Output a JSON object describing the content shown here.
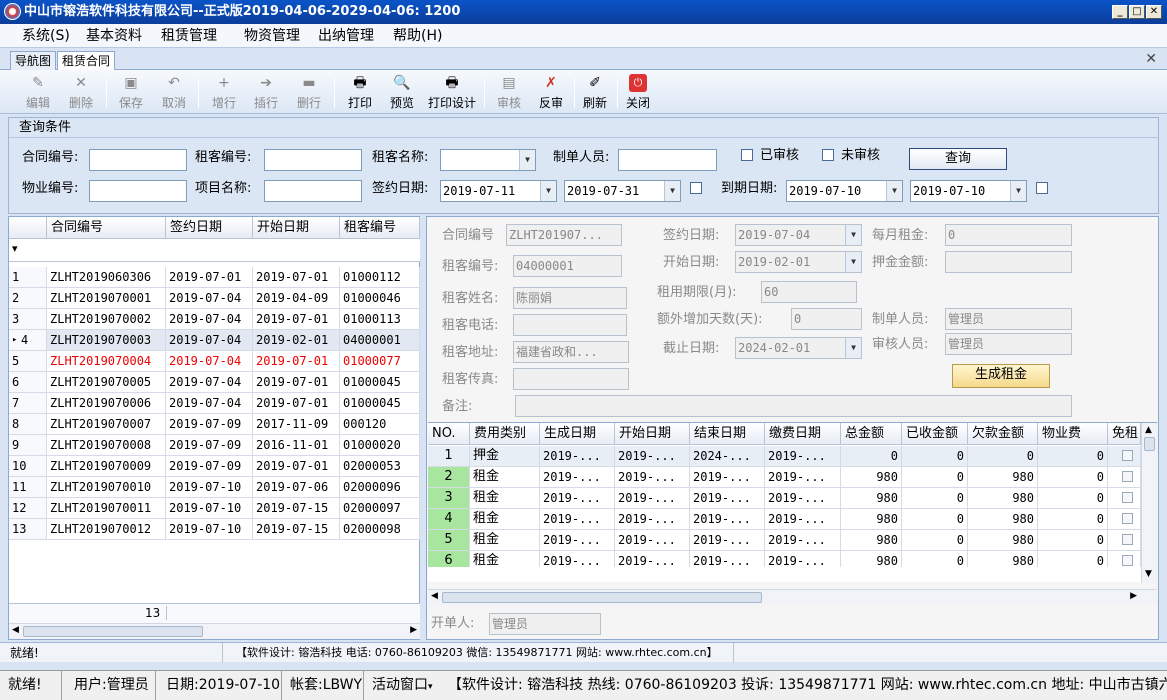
{
  "window": {
    "title": "中山市镕浩软件科技有限公司--正式版2019-04-06-2029-04-06: 1200"
  },
  "menu": [
    "系统(S)",
    "基本资料",
    "租赁管理",
    "物资管理",
    "出纳管理",
    "帮助(H)"
  ],
  "tabs": [
    "导航图",
    "租赁合同"
  ],
  "toolbar": [
    {
      "label": "编辑",
      "icon": "pencil-icon",
      "enabled": false
    },
    {
      "label": "删除",
      "icon": "delete-x-icon",
      "enabled": false
    },
    {
      "label": "保存",
      "icon": "save-icon",
      "enabled": false
    },
    {
      "label": "取消",
      "icon": "undo-icon",
      "enabled": false
    },
    {
      "label": "增行",
      "icon": "plus-icon",
      "enabled": false
    },
    {
      "label": "插行",
      "icon": "insert-arrow-icon",
      "enabled": false
    },
    {
      "label": "删行",
      "icon": "minus-icon",
      "enabled": false
    },
    {
      "label": "打印",
      "icon": "printer-icon",
      "enabled": true
    },
    {
      "label": "预览",
      "icon": "preview-icon",
      "enabled": true
    },
    {
      "label": "打印设计",
      "icon": "print-design-icon",
      "enabled": true
    },
    {
      "label": "审核",
      "icon": "approve-icon",
      "enabled": false
    },
    {
      "label": "反审",
      "icon": "unapprove-icon",
      "enabled": true
    },
    {
      "label": "刷新",
      "icon": "refresh-icon",
      "enabled": true
    },
    {
      "label": "关闭",
      "icon": "power-icon",
      "enabled": true
    }
  ],
  "query": {
    "title": "查询条件",
    "contract_no_label": "合同编号:",
    "tenant_no_label": "租客编号:",
    "tenant_name_label": "租客名称:",
    "creator_label": "制单人员:",
    "approved_label": "已审核",
    "unapproved_label": "未审核",
    "search_button": "查询",
    "property_no_label": "物业编号:",
    "project_name_label": "项目名称:",
    "sign_date_label": "签约日期:",
    "sign_date_from": "2019-07-11",
    "sign_date_to": "2019-07-31",
    "expire_date_label": "到期日期:",
    "expire_date_from": "2019-07-10",
    "expire_date_to": "2019-07-10"
  },
  "contract_grid": {
    "headers": [
      "合同编号",
      "签约日期",
      "开始日期",
      "租客编号"
    ],
    "filter_icon": "▾",
    "rows": [
      {
        "no": "1",
        "c": [
          "ZLHT2019060306",
          "2019-07-01",
          "2019-07-01",
          "01000112"
        ]
      },
      {
        "no": "2",
        "c": [
          "ZLHT2019070001",
          "2019-07-04",
          "2019-04-09",
          "01000046"
        ]
      },
      {
        "no": "3",
        "c": [
          "ZLHT2019070002",
          "2019-07-04",
          "2019-07-01",
          "01000113"
        ]
      },
      {
        "no": "4",
        "c": [
          "ZLHT2019070003",
          "2019-07-04",
          "2019-02-01",
          "04000001"
        ]
      },
      {
        "no": "5",
        "c": [
          "ZLHT2019070004",
          "2019-07-04",
          "2019-07-01",
          "01000077"
        ]
      },
      {
        "no": "6",
        "c": [
          "ZLHT2019070005",
          "2019-07-04",
          "2019-07-01",
          "01000045"
        ]
      },
      {
        "no": "7",
        "c": [
          "ZLHT2019070006",
          "2019-07-04",
          "2019-07-01",
          "01000045"
        ]
      },
      {
        "no": "8",
        "c": [
          "ZLHT2019070007",
          "2019-07-09",
          "2017-11-09",
          "000120"
        ]
      },
      {
        "no": "9",
        "c": [
          "ZLHT2019070008",
          "2019-07-09",
          "2016-11-01",
          "01000020"
        ]
      },
      {
        "no": "10",
        "c": [
          "ZLHT2019070009",
          "2019-07-09",
          "2019-07-01",
          "02000053"
        ]
      },
      {
        "no": "11",
        "c": [
          "ZLHT2019070010",
          "2019-07-10",
          "2019-07-06",
          "02000096"
        ]
      },
      {
        "no": "12",
        "c": [
          "ZLHT2019070011",
          "2019-07-10",
          "2019-07-15",
          "02000097"
        ]
      },
      {
        "no": "13",
        "c": [
          "ZLHT2019070012",
          "2019-07-10",
          "2019-07-15",
          "02000098"
        ]
      }
    ],
    "current_row": 4,
    "red_row": 5,
    "count": "13"
  },
  "detail_form": {
    "contract_no_label": "合同编号",
    "contract_no": "ZLHT201907...",
    "sign_date_label": "签约日期:",
    "sign_date": "2019-07-04",
    "monthly_rent_label": "每月租金:",
    "monthly_rent": "0",
    "tenant_no_label": "租客编号:",
    "tenant_no": "04000001",
    "start_date_label": "开始日期:",
    "start_date": "2019-02-01",
    "deposit_label": "押金金额:",
    "deposit": "",
    "tenant_name_label": "租客姓名:",
    "tenant_name": "陈丽娟",
    "term_label": "租用期限(月):",
    "term": "60",
    "tenant_phone_label": "租客电话:",
    "tenant_phone": "",
    "extra_days_label": "额外增加天数(天):",
    "extra_days": "0",
    "creator_label": "制单人员:",
    "creator": "管理员",
    "tenant_addr_label": "租客地址:",
    "tenant_addr": "福建省政和...",
    "end_date_label": "截止日期:",
    "end_date": "2024-02-01",
    "auditor_label": "审核人员:",
    "auditor": "管理员",
    "tenant_fax_label": "租客传真:",
    "tenant_fax": "",
    "gen_rent_button": "生成租金",
    "remark_label": "备注:",
    "remark": ""
  },
  "fee_grid": {
    "headers": [
      "NO.",
      "费用类别",
      "生成日期",
      "开始日期",
      "结束日期",
      "缴费日期",
      "总金额",
      "已收金额",
      "欠款金额",
      "物业费",
      "免租"
    ],
    "rows": [
      {
        "c": [
          "1",
          "押金",
          "2019-...",
          "2019-...",
          "2024-...",
          "2019-...",
          "0",
          "0",
          "0",
          "0"
        ]
      },
      {
        "c": [
          "2",
          "租金",
          "2019-...",
          "2019-...",
          "2019-...",
          "2019-...",
          "980",
          "0",
          "980",
          "0"
        ]
      },
      {
        "c": [
          "3",
          "租金",
          "2019-...",
          "2019-...",
          "2019-...",
          "2019-...",
          "980",
          "0",
          "980",
          "0"
        ]
      },
      {
        "c": [
          "4",
          "租金",
          "2019-...",
          "2019-...",
          "2019-...",
          "2019-...",
          "980",
          "0",
          "980",
          "0"
        ]
      },
      {
        "c": [
          "5",
          "租金",
          "2019-...",
          "2019-...",
          "2019-...",
          "2019-...",
          "980",
          "0",
          "980",
          "0"
        ]
      },
      {
        "c": [
          "6",
          "租金",
          "2019-...",
          "2019-...",
          "2019-...",
          "2019-...",
          "980",
          "0",
          "980",
          "0"
        ]
      }
    ]
  },
  "opener": {
    "label": "开单人:",
    "value": "管理员"
  },
  "status1": {
    "left": "就绪!",
    "center": "【软件设计: 镕浩科技 电话: 0760-86109203 微信: 13549871771 网站: www.rhtec.com.cn】"
  },
  "status2": {
    "ready": "就绪!",
    "user": "用户:管理员",
    "date": "日期:2019-07-10",
    "account": "帐套:LBWY",
    "active_window": "活动窗口",
    "info": "【软件设计: 镕浩科技 热线: 0760-86109203 投诉: 13549871771 网站: www.rhtec.com.cn 地址: 中山市古镇六坊"
  },
  "colors": {
    "accent": "#0b3d9a",
    "panel": "#d8e4f3",
    "red_row": "#e00000",
    "green_no": "#a8e6a0"
  }
}
